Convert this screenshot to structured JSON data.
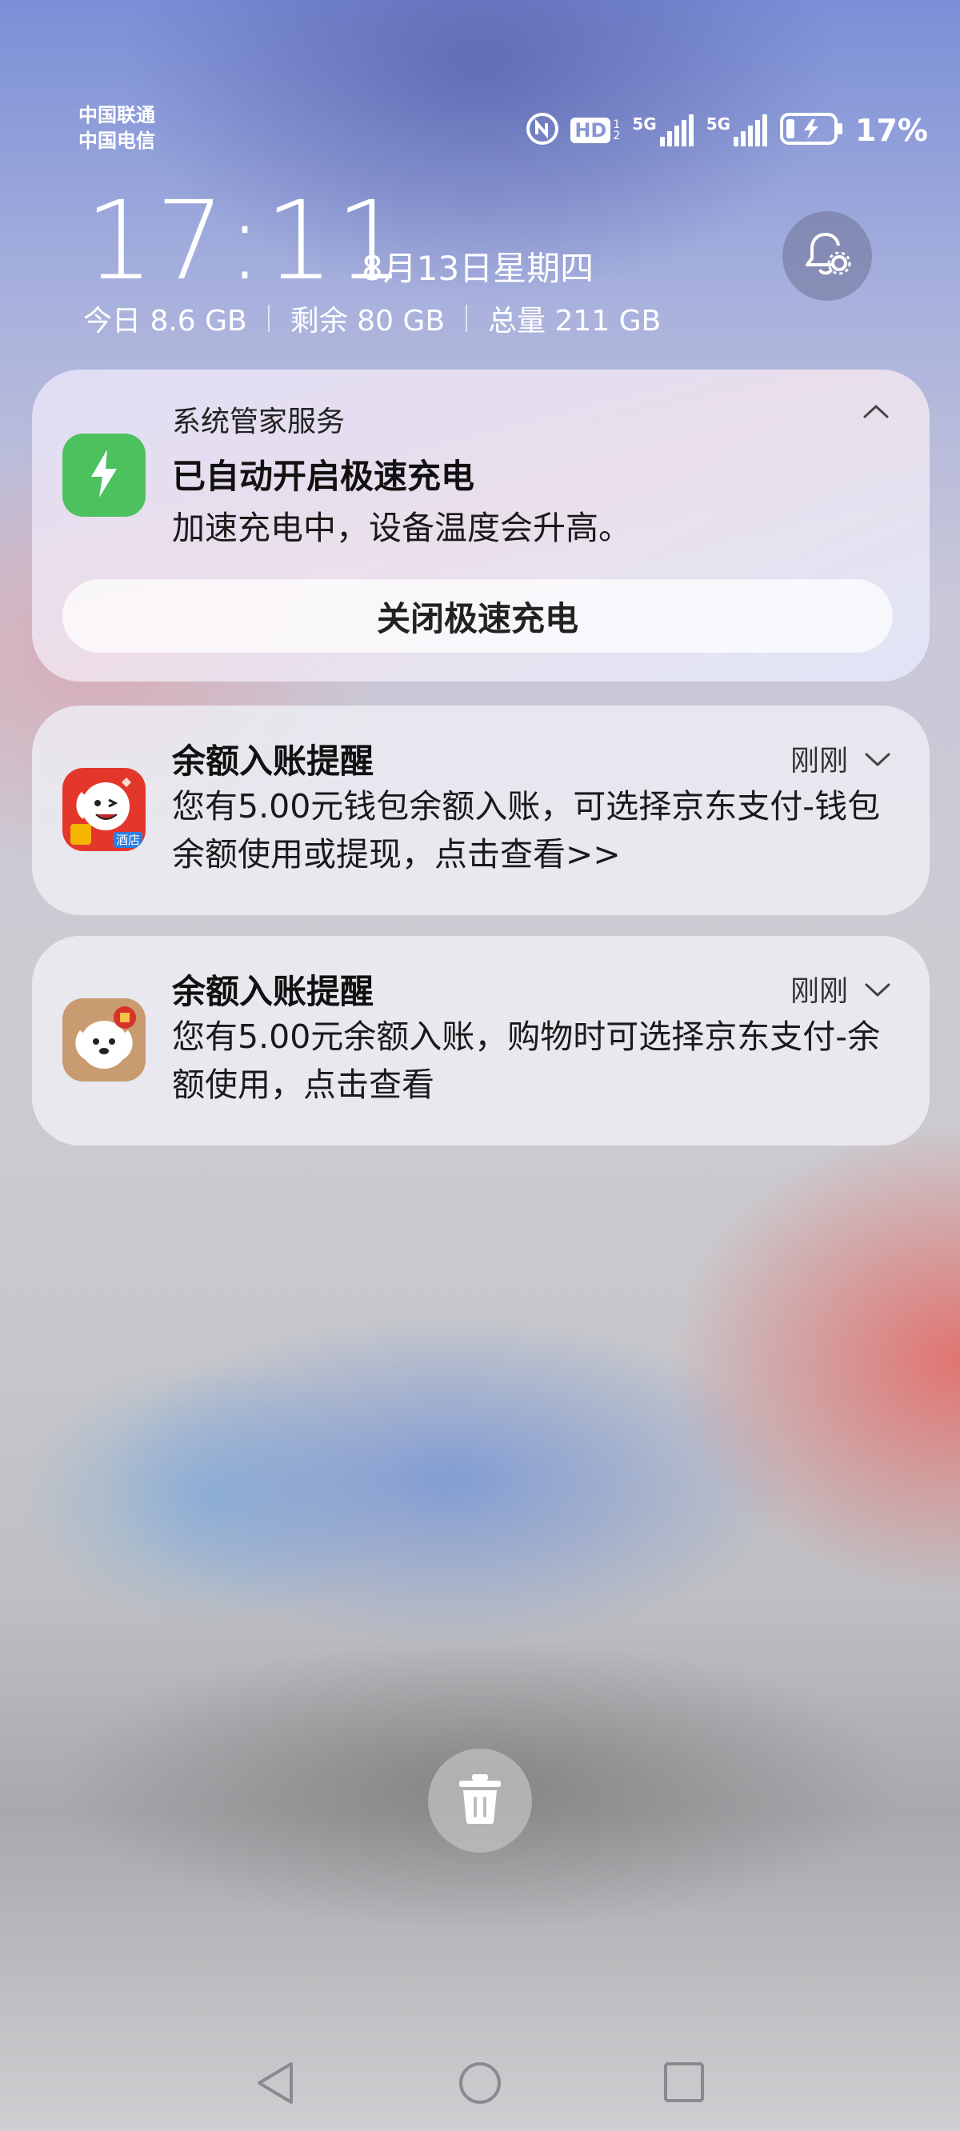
{
  "status_bar": {
    "carrier1": "中国联通",
    "carrier2": "中国电信",
    "hd_label": "HD",
    "sim_tag": "1 2",
    "net1": "5G",
    "net2": "5G",
    "battery_percent": "17%",
    "icons": [
      "nfc-icon",
      "hd-voice-icon",
      "signal-5g-icon",
      "signal-5g-icon",
      "battery-charging-icon"
    ]
  },
  "lockscreen": {
    "time": "17:11",
    "date": "8月13日星期四",
    "storage": {
      "today": "今日 8.6 GB",
      "remaining": "剩余 80 GB",
      "total": "总量 211 GB"
    }
  },
  "notifications": [
    {
      "app_name": "系统管家服务",
      "title": "已自动开启极速充电",
      "body": "加速充电中，设备温度会升高。",
      "action": "关闭极速充电",
      "icon": "lightning-icon",
      "expanded": true
    },
    {
      "title": "余额入账提醒",
      "time": "刚刚",
      "body": "您有5.00元钱包余额入账，可选择京东支付-钱包余额使用或提现，点击查看>>",
      "icon": "jd-hotel-app-icon",
      "icon_badge": "酒店"
    },
    {
      "title": "余额入账提醒",
      "time": "刚刚",
      "body": "您有5.00元余额入账，购物时可选择京东支付-余额使用，点击查看",
      "icon": "jd-finance-app-icon"
    }
  ],
  "controls": {
    "clear_all": "trash-icon",
    "nav": [
      "back-icon",
      "home-icon",
      "recents-icon"
    ]
  },
  "colors": {
    "charge_green": "#4cc15e",
    "jd_red": "#e0322a",
    "jd_tan": "#c59a6e"
  }
}
